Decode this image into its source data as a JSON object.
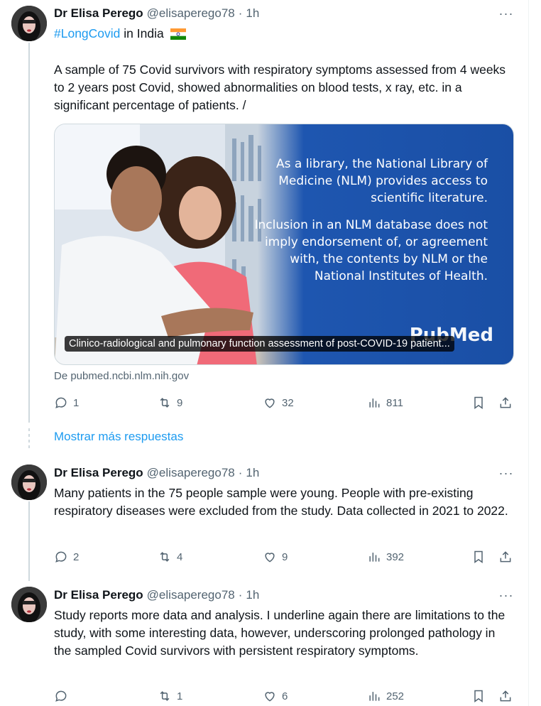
{
  "tweets": [
    {
      "name": "Dr Elisa Perego",
      "handle": "@elisaperego78",
      "dot": "·",
      "time": "1h",
      "more": "···",
      "hashtag": "#LongCovid",
      "first_line_rest": " in India",
      "flag": "🇮🇳",
      "body": "A sample of 75 Covid survivors with respiratory symptoms assessed from 4 weeks to 2 years post Covid, showed abnormalities on blood tests, x ray, etc. in a significant percentage of patients. /",
      "card": {
        "text_p1": "As a library, the National Library of Medicine (NLM) provides access to scientific literature.",
        "text_p2": "Inclusion in an NLM database does not imply endorsement of, or agreement with, the contents by NLM or the National Institutes of Health.",
        "logo": "PubMed",
        "caption": "Clinico-radiological and pulmonary function assessment of post-COVID-19 patient...",
        "source": "De pubmed.ncbi.nlm.nih.gov"
      },
      "replies": "1",
      "retweets": "9",
      "likes": "32",
      "views": "811"
    },
    {
      "name": "Dr Elisa Perego",
      "handle": "@elisaperego78",
      "dot": "·",
      "time": "1h",
      "more": "···",
      "body": "Many patients in the 75 people sample were young. People with pre-existing respiratory diseases were excluded from the study. Data collected in 2021 to 2022.",
      "replies": "2",
      "retweets": "4",
      "likes": "9",
      "views": "392"
    },
    {
      "name": "Dr Elisa Perego",
      "handle": "@elisaperego78",
      "dot": "·",
      "time": "1h",
      "more": "···",
      "body": "Study reports more data and analysis. I underline again there are limitations to the study, with some interesting data, however, underscoring prolonged pathology in the sampled Covid survivors with persistent respiratory symptoms.",
      "replies": "",
      "retweets": "1",
      "likes": "6",
      "views": "252"
    }
  ],
  "show_more_label": "Mostrar más respuestas",
  "icons": {
    "reply": "reply-icon",
    "retweet": "retweet-icon",
    "like": "heart-icon",
    "views": "views-chart-icon",
    "bookmark": "bookmark-icon",
    "share": "share-icon"
  },
  "colors": {
    "accent": "#1d9bf0",
    "muted": "#536471",
    "card_blue": "#1a4fa5"
  }
}
